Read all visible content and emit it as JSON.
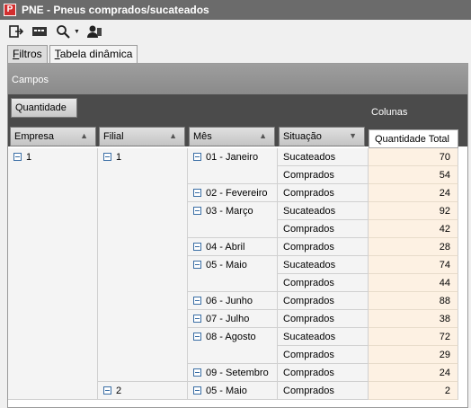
{
  "window": {
    "title": "PNE - Pneus comprados/sucateados",
    "app_icon": "P"
  },
  "toolbar": {
    "icons": [
      "exit-icon",
      "card-icon",
      "search-icon",
      "user-icon"
    ],
    "search_dropdown": "▼"
  },
  "tabs": [
    {
      "label_prefix": "F",
      "label_rest": "iltros",
      "active": true
    },
    {
      "label_prefix": "T",
      "label_rest": "abela dinâmica",
      "active": false
    }
  ],
  "pivot": {
    "campos_label": "Campos",
    "data_field": "Quantidade",
    "columns_label": "Colunas",
    "row_fields": [
      {
        "label": "Empresa",
        "sort": "▲"
      },
      {
        "label": "Filial",
        "sort": "▲"
      },
      {
        "label": "Mês",
        "sort": "▲"
      },
      {
        "label": "Situação",
        "sort": "▼"
      }
    ],
    "column_header": "Quantidade Total",
    "empresa": "1",
    "filiais": [
      "1",
      "2"
    ],
    "months": [
      {
        "label": "01 - Janeiro",
        "filial": "1"
      },
      {
        "label": "02 - Fevereiro",
        "filial": "1"
      },
      {
        "label": "03 - Março",
        "filial": "1"
      },
      {
        "label": "04 - Abril",
        "filial": "1"
      },
      {
        "label": "05 - Maio",
        "filial": "1"
      },
      {
        "label": "06 - Junho",
        "filial": "1"
      },
      {
        "label": "07 - Julho",
        "filial": "1"
      },
      {
        "label": "08 - Agosto",
        "filial": "1"
      },
      {
        "label": "09 - Setembro",
        "filial": "1"
      },
      {
        "label": "05 - Maio",
        "filial": "2"
      }
    ],
    "rows": [
      {
        "situacao": "Sucateados",
        "value": "70"
      },
      {
        "situacao": "Comprados",
        "value": "54"
      },
      {
        "situacao": "Comprados",
        "value": "24"
      },
      {
        "situacao": "Sucateados",
        "value": "92"
      },
      {
        "situacao": "Comprados",
        "value": "42"
      },
      {
        "situacao": "Comprados",
        "value": "28"
      },
      {
        "situacao": "Sucateados",
        "value": "74"
      },
      {
        "situacao": "Comprados",
        "value": "44"
      },
      {
        "situacao": "Comprados",
        "value": "88"
      },
      {
        "situacao": "Comprados",
        "value": "38"
      },
      {
        "situacao": "Sucateados",
        "value": "72"
      },
      {
        "situacao": "Comprados",
        "value": "29"
      },
      {
        "situacao": "Comprados",
        "value": "24"
      },
      {
        "situacao": "Comprados",
        "value": "2"
      }
    ]
  }
}
